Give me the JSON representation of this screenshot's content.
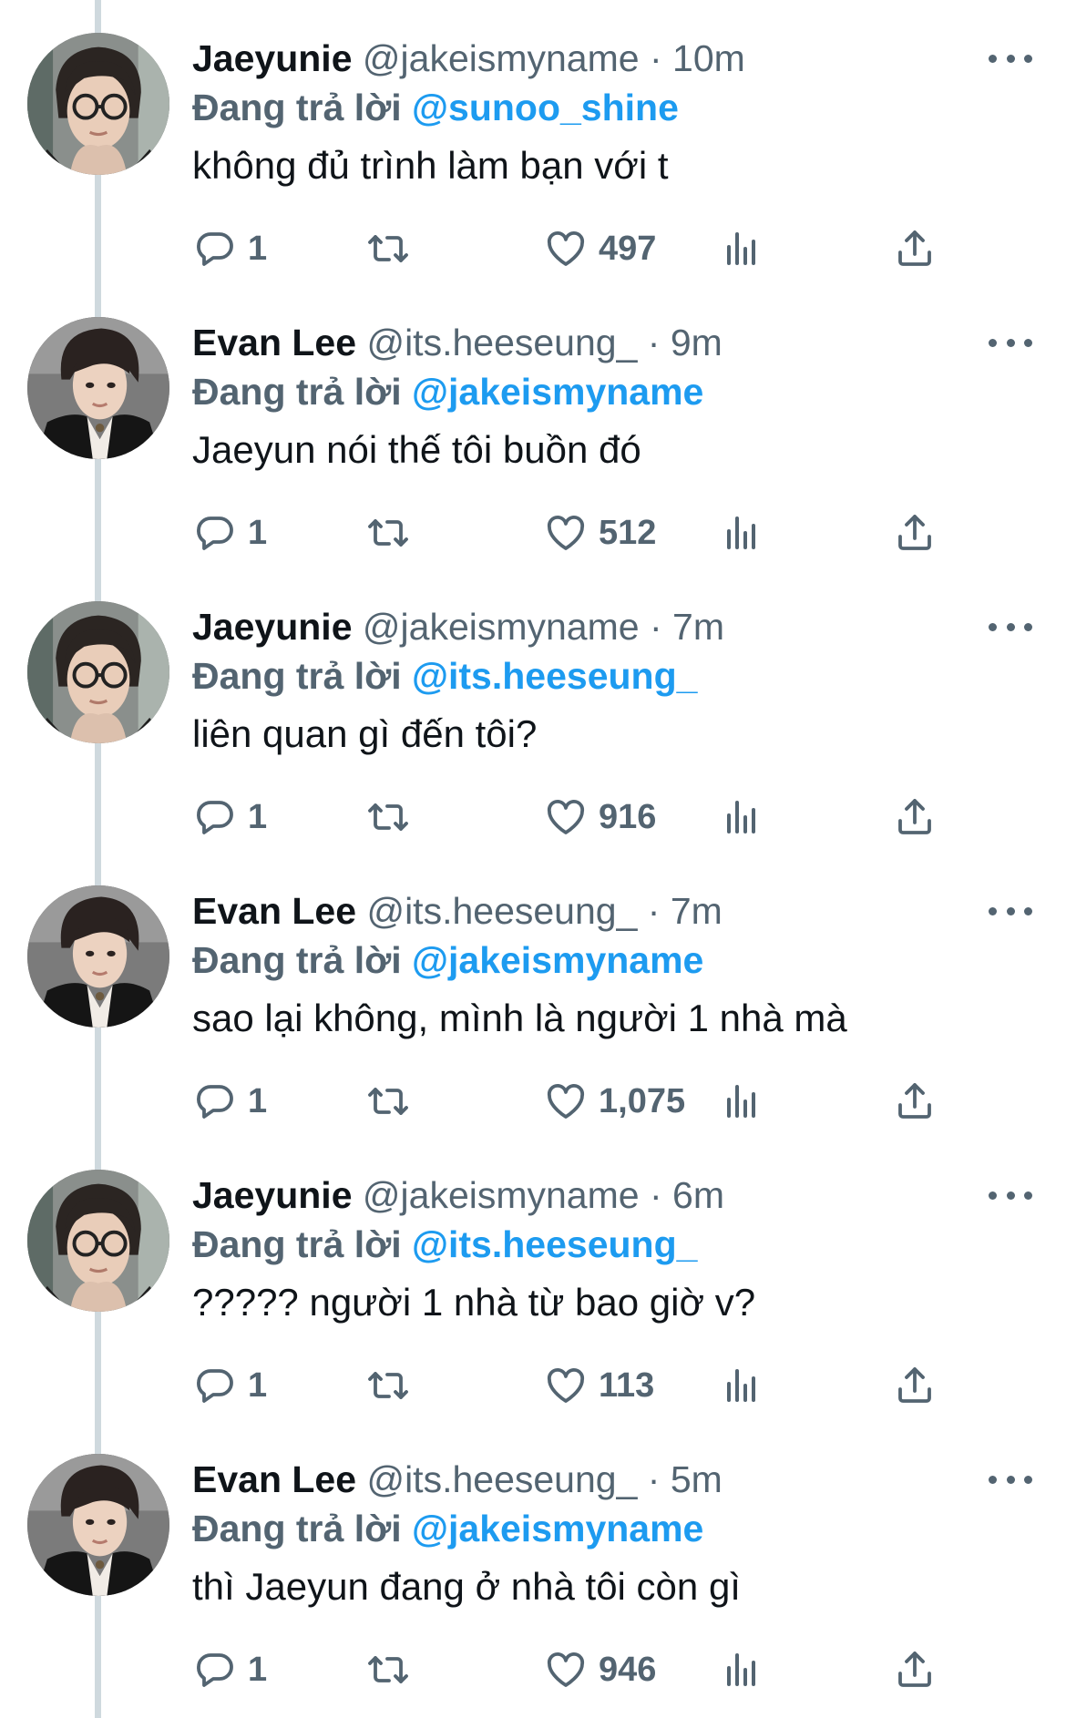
{
  "colors": {
    "text": "#0f1419",
    "secondary": "#536471",
    "mention": "#1d9bf0",
    "thread_line": "#cfd9de"
  },
  "icons": {
    "more": "more-icon",
    "reply": "reply-icon",
    "retweet": "retweet-icon",
    "like": "like-icon",
    "views": "views-icon",
    "share": "share-icon"
  },
  "tweets": [
    {
      "author": "jaeyunie",
      "name": "Jaeyunie",
      "handle": "@jakeismyname",
      "time": "· 10m",
      "reply_prefix": "Đang trả lời",
      "reply_to": "@sunoo_shine",
      "text": "không đủ trình làm bạn với t",
      "replies": "1",
      "likes": "497"
    },
    {
      "author": "evan",
      "name": "Evan Lee",
      "handle": "@its.heeseung_",
      "time": "· 9m",
      "reply_prefix": "Đang trả lời",
      "reply_to": "@jakeismyname",
      "text": "Jaeyun nói thế tôi buồn đó",
      "replies": "1",
      "likes": "512"
    },
    {
      "author": "jaeyunie",
      "name": "Jaeyunie",
      "handle": "@jakeismyname",
      "time": "· 7m",
      "reply_prefix": "Đang trả lời",
      "reply_to": "@its.heeseung_",
      "text": "liên quan gì đến tôi?",
      "replies": "1",
      "likes": "916"
    },
    {
      "author": "evan",
      "name": "Evan Lee",
      "handle": "@its.heeseung_",
      "time": "· 7m",
      "reply_prefix": "Đang trả lời",
      "reply_to": "@jakeismyname",
      "text": "sao lại không, mình là người 1 nhà mà",
      "replies": "1",
      "likes": "1,075"
    },
    {
      "author": "jaeyunie",
      "name": "Jaeyunie",
      "handle": "@jakeismyname",
      "time": "· 6m",
      "reply_prefix": "Đang trả lời",
      "reply_to": "@its.heeseung_",
      "text": "????? người 1 nhà từ bao giờ v?",
      "replies": "1",
      "likes": "113"
    },
    {
      "author": "evan",
      "name": "Evan Lee",
      "handle": "@its.heeseung_",
      "time": "· 5m",
      "reply_prefix": "Đang trả lời",
      "reply_to": "@jakeismyname",
      "text": "thì Jaeyun đang ở nhà tôi còn gì",
      "replies": "1",
      "likes": "946"
    }
  ]
}
